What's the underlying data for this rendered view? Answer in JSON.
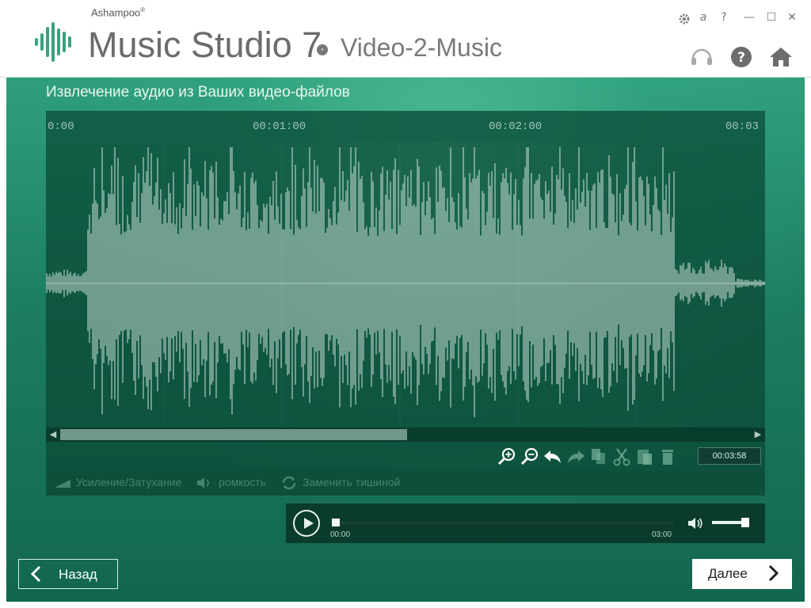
{
  "app": {
    "vendor": "Ashampoo",
    "vendor_mark": "®",
    "product": "Music Studio 7",
    "module": "Video-2-Music"
  },
  "window_controls": {
    "settings_icon": "gear-icon",
    "language_symbol": "a",
    "help_symbol": "?",
    "minimize_symbol": "—",
    "maximize_symbol": "☐",
    "close_symbol": "✕"
  },
  "header_icons": [
    "headset-icon",
    "help-circle-icon",
    "home-icon"
  ],
  "main": {
    "title": "Извлечение аудио из Ваших видео-файлов"
  },
  "timeline": {
    "ticks": [
      "0:00",
      "00:01:00",
      "00:02:00",
      "00:03"
    ]
  },
  "toolbar": {
    "tools": [
      "zoom-in-icon",
      "zoom-out-icon",
      "undo-icon",
      "redo-icon",
      "copy-icon",
      "cut-icon",
      "paste-icon",
      "delete-icon"
    ],
    "duration": "00:03:58"
  },
  "effects": {
    "fade": "Усиление/Затухание",
    "volume": "ромкость",
    "silence": "Заменить тишиной"
  },
  "player": {
    "current": "00:00",
    "total": "03:00",
    "progress": 0.0,
    "volume_level": 0.85
  },
  "nav": {
    "back_label": "Назад",
    "next_label": "Далее"
  },
  "colors": {
    "accent_green": "#1c7d60",
    "logo_green": "#3aa17e"
  }
}
